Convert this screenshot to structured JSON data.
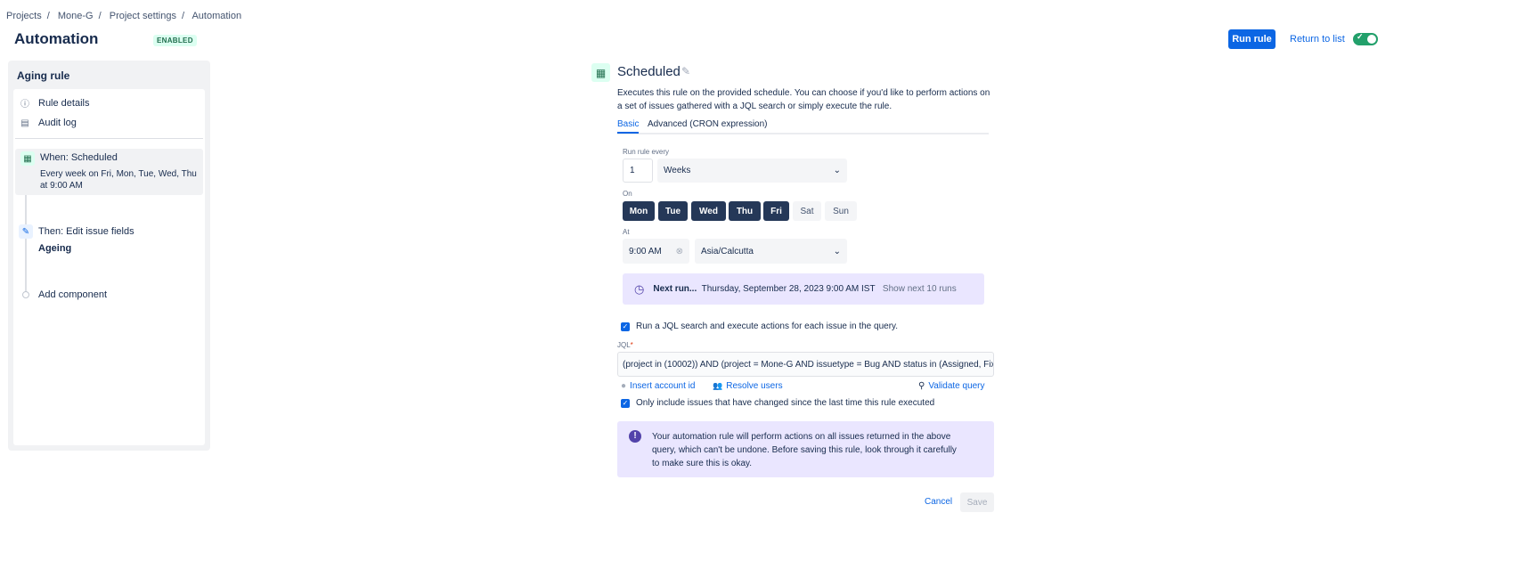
{
  "breadcrumb": [
    "Projects",
    "Mone-G",
    "Project settings",
    "Automation"
  ],
  "header": {
    "title": "Automation",
    "badge": "ENABLED",
    "run_rule": "Run rule",
    "return_to_list": "Return to list",
    "toggle_on": true
  },
  "sidebar": {
    "title": "Aging rule",
    "items": [
      {
        "label": "Rule details",
        "icon": "info-icon"
      },
      {
        "label": "Audit log",
        "icon": "document-icon"
      }
    ],
    "steps": [
      {
        "title": "When: Scheduled",
        "detail": "Every week on Fri, Mon, Tue, Wed, Thu at 9:00 AM",
        "icon": "calendar-icon"
      },
      {
        "title": "Then: Edit issue fields",
        "detail": "Ageing",
        "icon": "pencil-icon"
      }
    ],
    "add_component": "Add component"
  },
  "main": {
    "title": "Scheduled",
    "description": "Executes this rule on the provided schedule. You can choose if you'd like to perform actions on a set of issues gathered with a JQL search or simply execute the rule.",
    "tabs": [
      "Basic",
      "Advanced (CRON expression)"
    ],
    "run_every_label": "Run rule every",
    "run_every_value": "1",
    "run_every_unit": "Weeks",
    "on_label": "On",
    "days": [
      {
        "label": "Mon",
        "on": true
      },
      {
        "label": "Tue",
        "on": true
      },
      {
        "label": "Wed",
        "on": true
      },
      {
        "label": "Thu",
        "on": true
      },
      {
        "label": "Fri",
        "on": true
      },
      {
        "label": "Sat",
        "on": false
      },
      {
        "label": "Sun",
        "on": false
      }
    ],
    "at_label": "At",
    "time": "9:00 AM",
    "timezone": "Asia/Calcutta",
    "next_run_label": "Next run...",
    "next_run_value": "Thursday, September 28, 2023 9:00 AM IST",
    "show_next": "Show next 10 runs",
    "jql_checkbox": "Run a JQL search and execute actions for each issue in the query.",
    "jql_label": "JQL",
    "jql_required": "*",
    "jql_value": "(project in (10002)) AND (project = Mone-G AND issuetype = Bug AND status in (Assigned, Fixed",
    "insert_account_id": "Insert account id",
    "resolve_users": "Resolve users",
    "validate_query": "Validate query",
    "only_changed_checkbox": "Only include issues that have changed since the last time this rule executed",
    "warning": "Your automation rule will perform actions on all issues returned in the above query, which can't be undone. Before saving this rule, look through it carefully to make sure this is okay.",
    "cancel": "Cancel",
    "save": "Save"
  },
  "colors": {
    "primary": "#0c66e4",
    "day_selected": "#253858",
    "info_bg": "#eae6ff",
    "success": "#22a06b"
  }
}
